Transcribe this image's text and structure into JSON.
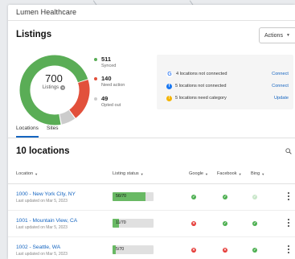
{
  "header": {
    "brand": "Lumen Healthcare"
  },
  "page": {
    "title": "Listings",
    "actions_label": "Actions"
  },
  "summary": {
    "total": "700",
    "total_label": "Listings",
    "legend": [
      {
        "value": "511",
        "label": "Synced",
        "color": "#5aad56"
      },
      {
        "value": "140",
        "label": "Need action",
        "color": "#e2503b"
      },
      {
        "value": "49",
        "label": "Opted out",
        "color": "#cccccc"
      }
    ],
    "chart_data": {
      "type": "pie",
      "categories": [
        "Synced",
        "Need action",
        "Opted out"
      ],
      "values": [
        511,
        140,
        49
      ]
    }
  },
  "issues": [
    {
      "icon": "google-icon",
      "text": "4 locations not connected",
      "action": "Connect"
    },
    {
      "icon": "facebook-icon",
      "text": "5 locations not connected",
      "action": "Connect"
    },
    {
      "icon": "category-warning-icon",
      "text": "5 locations need category",
      "action": "Update"
    }
  ],
  "tabs": [
    {
      "label": "Locations",
      "active": true
    },
    {
      "label": "Sites",
      "active": false
    }
  ],
  "table": {
    "title": "10 locations",
    "columns": {
      "location": "Location",
      "status": "Listing status",
      "google": "Google",
      "facebook": "Facebook",
      "bing": "Bing"
    },
    "rows": [
      {
        "name": "1000 - New York City, NY",
        "updated": "Last updated on Mar 5, 2023",
        "status_text": "56/70",
        "progress": 0.8,
        "google": "ok",
        "facebook": "ok",
        "bing": "pending"
      },
      {
        "name": "1001 - Mountain View, CA",
        "updated": "Last updated on Mar 5, 2023",
        "status_text": "11/70",
        "progress": 0.157,
        "google": "no",
        "facebook": "ok",
        "bing": "ok"
      },
      {
        "name": "1002 - Seattle, WA",
        "updated": "Last updated on Mar 5, 2023",
        "status_text": "5/70",
        "progress": 0.07,
        "google": "no",
        "facebook": "no",
        "bing": "ok"
      }
    ]
  }
}
